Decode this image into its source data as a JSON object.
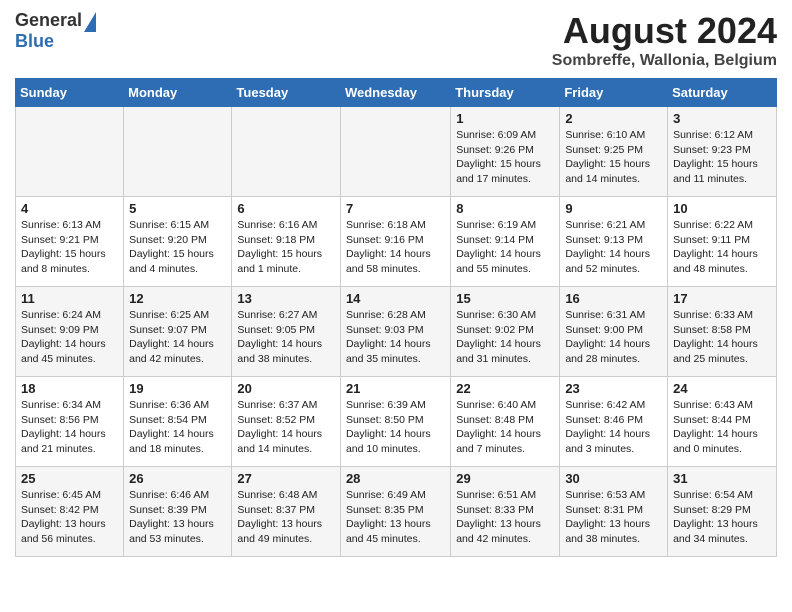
{
  "logo": {
    "general": "General",
    "blue": "Blue"
  },
  "title": {
    "month_year": "August 2024",
    "location": "Sombreffe, Wallonia, Belgium"
  },
  "header_days": [
    "Sunday",
    "Monday",
    "Tuesday",
    "Wednesday",
    "Thursday",
    "Friday",
    "Saturday"
  ],
  "weeks": [
    [
      {
        "day": "",
        "content": ""
      },
      {
        "day": "",
        "content": ""
      },
      {
        "day": "",
        "content": ""
      },
      {
        "day": "",
        "content": ""
      },
      {
        "day": "1",
        "content": "Sunrise: 6:09 AM\nSunset: 9:26 PM\nDaylight: 15 hours and 17 minutes."
      },
      {
        "day": "2",
        "content": "Sunrise: 6:10 AM\nSunset: 9:25 PM\nDaylight: 15 hours and 14 minutes."
      },
      {
        "day": "3",
        "content": "Sunrise: 6:12 AM\nSunset: 9:23 PM\nDaylight: 15 hours and 11 minutes."
      }
    ],
    [
      {
        "day": "4",
        "content": "Sunrise: 6:13 AM\nSunset: 9:21 PM\nDaylight: 15 hours and 8 minutes."
      },
      {
        "day": "5",
        "content": "Sunrise: 6:15 AM\nSunset: 9:20 PM\nDaylight: 15 hours and 4 minutes."
      },
      {
        "day": "6",
        "content": "Sunrise: 6:16 AM\nSunset: 9:18 PM\nDaylight: 15 hours and 1 minute."
      },
      {
        "day": "7",
        "content": "Sunrise: 6:18 AM\nSunset: 9:16 PM\nDaylight: 14 hours and 58 minutes."
      },
      {
        "day": "8",
        "content": "Sunrise: 6:19 AM\nSunset: 9:14 PM\nDaylight: 14 hours and 55 minutes."
      },
      {
        "day": "9",
        "content": "Sunrise: 6:21 AM\nSunset: 9:13 PM\nDaylight: 14 hours and 52 minutes."
      },
      {
        "day": "10",
        "content": "Sunrise: 6:22 AM\nSunset: 9:11 PM\nDaylight: 14 hours and 48 minutes."
      }
    ],
    [
      {
        "day": "11",
        "content": "Sunrise: 6:24 AM\nSunset: 9:09 PM\nDaylight: 14 hours and 45 minutes."
      },
      {
        "day": "12",
        "content": "Sunrise: 6:25 AM\nSunset: 9:07 PM\nDaylight: 14 hours and 42 minutes."
      },
      {
        "day": "13",
        "content": "Sunrise: 6:27 AM\nSunset: 9:05 PM\nDaylight: 14 hours and 38 minutes."
      },
      {
        "day": "14",
        "content": "Sunrise: 6:28 AM\nSunset: 9:03 PM\nDaylight: 14 hours and 35 minutes."
      },
      {
        "day": "15",
        "content": "Sunrise: 6:30 AM\nSunset: 9:02 PM\nDaylight: 14 hours and 31 minutes."
      },
      {
        "day": "16",
        "content": "Sunrise: 6:31 AM\nSunset: 9:00 PM\nDaylight: 14 hours and 28 minutes."
      },
      {
        "day": "17",
        "content": "Sunrise: 6:33 AM\nSunset: 8:58 PM\nDaylight: 14 hours and 25 minutes."
      }
    ],
    [
      {
        "day": "18",
        "content": "Sunrise: 6:34 AM\nSunset: 8:56 PM\nDaylight: 14 hours and 21 minutes."
      },
      {
        "day": "19",
        "content": "Sunrise: 6:36 AM\nSunset: 8:54 PM\nDaylight: 14 hours and 18 minutes."
      },
      {
        "day": "20",
        "content": "Sunrise: 6:37 AM\nSunset: 8:52 PM\nDaylight: 14 hours and 14 minutes."
      },
      {
        "day": "21",
        "content": "Sunrise: 6:39 AM\nSunset: 8:50 PM\nDaylight: 14 hours and 10 minutes."
      },
      {
        "day": "22",
        "content": "Sunrise: 6:40 AM\nSunset: 8:48 PM\nDaylight: 14 hours and 7 minutes."
      },
      {
        "day": "23",
        "content": "Sunrise: 6:42 AM\nSunset: 8:46 PM\nDaylight: 14 hours and 3 minutes."
      },
      {
        "day": "24",
        "content": "Sunrise: 6:43 AM\nSunset: 8:44 PM\nDaylight: 14 hours and 0 minutes."
      }
    ],
    [
      {
        "day": "25",
        "content": "Sunrise: 6:45 AM\nSunset: 8:42 PM\nDaylight: 13 hours and 56 minutes."
      },
      {
        "day": "26",
        "content": "Sunrise: 6:46 AM\nSunset: 8:39 PM\nDaylight: 13 hours and 53 minutes."
      },
      {
        "day": "27",
        "content": "Sunrise: 6:48 AM\nSunset: 8:37 PM\nDaylight: 13 hours and 49 minutes."
      },
      {
        "day": "28",
        "content": "Sunrise: 6:49 AM\nSunset: 8:35 PM\nDaylight: 13 hours and 45 minutes."
      },
      {
        "day": "29",
        "content": "Sunrise: 6:51 AM\nSunset: 8:33 PM\nDaylight: 13 hours and 42 minutes."
      },
      {
        "day": "30",
        "content": "Sunrise: 6:53 AM\nSunset: 8:31 PM\nDaylight: 13 hours and 38 minutes."
      },
      {
        "day": "31",
        "content": "Sunrise: 6:54 AM\nSunset: 8:29 PM\nDaylight: 13 hours and 34 minutes."
      }
    ]
  ]
}
